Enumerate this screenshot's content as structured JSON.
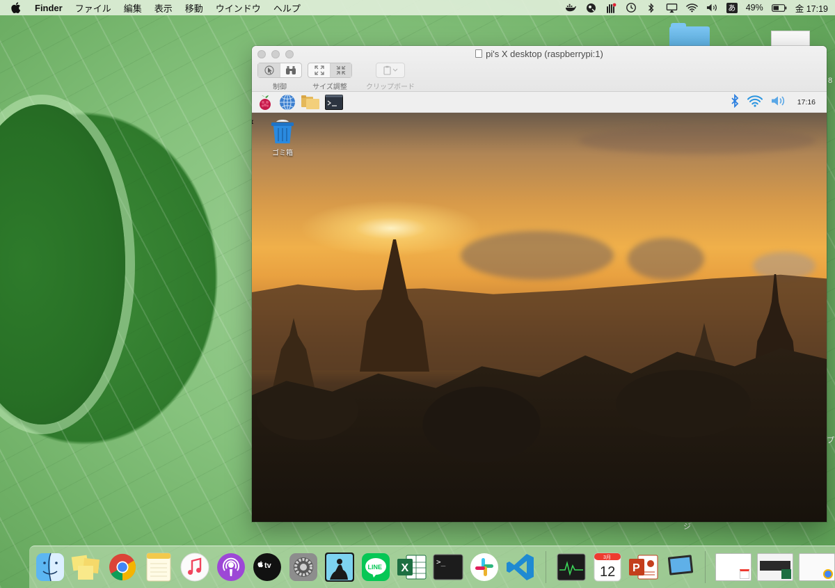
{
  "menubar": {
    "app_name": "Finder",
    "items": [
      "ファイル",
      "編集",
      "表示",
      "移動",
      "ウインドウ",
      "ヘルプ"
    ],
    "input_mode": "あ",
    "battery": "49%",
    "clock": "金 17:19"
  },
  "vnc_window": {
    "title": "pi's X desktop (raspberrypi:1)",
    "toolbar": {
      "control_label": "制御",
      "resize_label": "サイズ調整",
      "clipboard_label": "クリップボード"
    }
  },
  "pi": {
    "clock": "17:16",
    "trash_label": "ゴミ箱"
  },
  "desktop_side": {
    "letter_right": "プ",
    "letter_bottom": "ジ",
    "letter_top": "8"
  },
  "dock": {
    "apps": [
      "finder-icon",
      "stickies-icon",
      "chrome-icon",
      "notes-icon",
      "music-icon",
      "podcasts-icon",
      "appletv-icon",
      "system-preferences-icon",
      "kindle-icon",
      "line-icon",
      "excel-icon",
      "terminal-icon",
      "slack-icon",
      "vscode-icon"
    ],
    "line_label": "LINE",
    "calendar_month": "3月",
    "calendar_day": "12",
    "excel_letter": "X",
    "powerpoint_letter": "P",
    "appletv_label": "tv",
    "terminal_prompt": ">_"
  }
}
